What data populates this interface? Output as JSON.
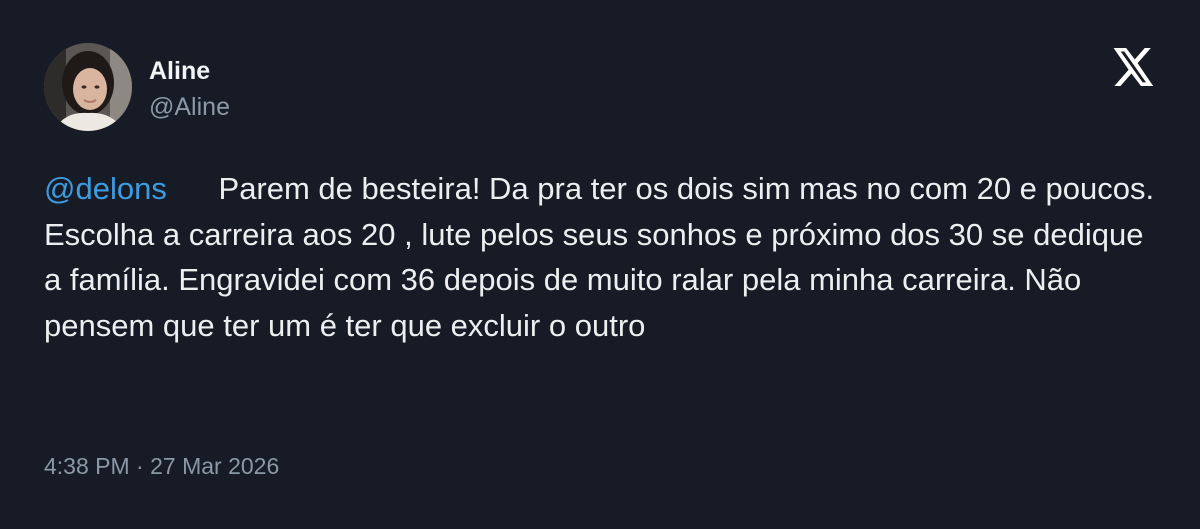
{
  "author": {
    "display_name": "Aline",
    "handle": "@Aline"
  },
  "tweet": {
    "mention": "@delons",
    "body": "Parem de besteira! Da pra ter os dois sim mas no com 20 e poucos. Escolha a carreira aos 20 , lute pelos seus sonhos e próximo dos 30 se dedique a família. Engravidei com 36 depois de muito ralar pela minha carreira. Não pensem que ter um é ter que excluir o outro",
    "timestamp": "4:38 PM · 27 Mar 2026"
  },
  "icons": {
    "platform_logo": "x-logo-icon"
  },
  "colors": {
    "background": "#161b26",
    "mention": "#3d9be0",
    "secondary_text": "#8b98a5"
  }
}
